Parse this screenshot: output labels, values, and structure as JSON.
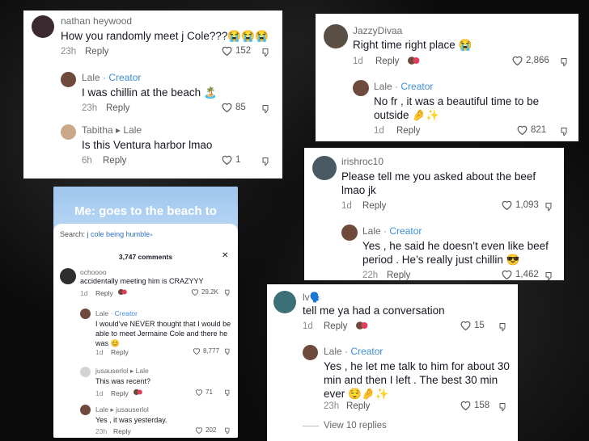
{
  "card1": {
    "c1": {
      "user": "nathan heywood",
      "text": "How you randomly meet j Cole???😭😭😭",
      "time": "23h",
      "reply": "Reply",
      "likes": "152"
    },
    "c2": {
      "user": "Lale",
      "creator": "· Creator",
      "text": "I was chillin at the beach 🏝️",
      "time": "23h",
      "reply": "Reply",
      "likes": "85"
    },
    "c3": {
      "user": "Tabitha",
      "to": "▸ Lale",
      "text": "Is this Ventura harbor lmao",
      "time": "6h",
      "reply": "Reply",
      "likes": "1"
    }
  },
  "card2": {
    "c1": {
      "user": "JazzyDivaa",
      "text": "Right time right place 😭",
      "time": "1d",
      "reply": "Reply",
      "likes": "2,866"
    },
    "c2": {
      "user": "Lale",
      "creator": "· Creator",
      "text": "No fr , it was a beautiful time to be outside 🤌✨",
      "time": "1d",
      "reply": "Reply",
      "likes": "821"
    }
  },
  "card3": {
    "c1": {
      "user": "irishroc10",
      "text": "Please tell me you asked about the beef lmao jk",
      "time": "1d",
      "reply": "Reply",
      "likes": "1,093"
    },
    "c2": {
      "user": "Lale",
      "creator": "· Creator",
      "text": "Yes , he said he doesn’t even like beef period . He’s really just chillin 😎",
      "time": "22h",
      "reply": "Reply",
      "likes": "1,462"
    }
  },
  "card4": {
    "c1": {
      "user": "lv🗣️",
      "text": "tell me ya had a conversation",
      "time": "1d",
      "reply": "Reply",
      "likes": "15"
    },
    "c2": {
      "user": "Lale",
      "creator": "· Creator",
      "text": "Yes , he let me talk to him for about 30 min and then I left . The best 30 min ever 😌🤌✨",
      "time": "23h",
      "reply": "Reply",
      "likes": "158"
    },
    "view_replies": "View 10 replies"
  },
  "phone": {
    "title": "Me: goes to the beach to",
    "search_label": "Search:",
    "search_query": "j cole being humble",
    "comments_count": "3,747 comments",
    "close": "✕",
    "c1": {
      "user": "ochoooo",
      "text": "accidentally meeting him is CRAZYYY",
      "time": "1d",
      "reply": "Reply",
      "likes": "29.2K"
    },
    "c2": {
      "user": "Lale",
      "creator": "· Creator",
      "text": "I would’ve NEVER thought that I would be able to meet Jermaine Cole and there he was 😊",
      "time": "1d",
      "reply": "Reply",
      "likes": "8,777"
    },
    "c3": {
      "user": "jusauserlol",
      "to": "▸ Lale",
      "text": "This was recent?",
      "time": "1d",
      "reply": "Reply",
      "likes": "71"
    },
    "c4": {
      "user": "Lale",
      "to": "▸ jusauserlol",
      "text": "Yes , it was yesterday.",
      "time": "23h",
      "reply": "Reply",
      "likes": "202"
    }
  }
}
